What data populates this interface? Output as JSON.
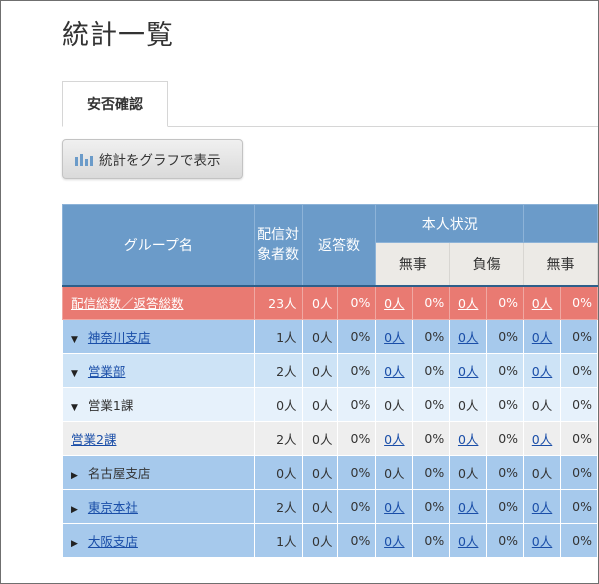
{
  "page": {
    "title": "統計一覧",
    "tab_label": "安否確認",
    "graph_button_label": "統計をグラフで表示",
    "graph_icon": "bar-chart-icon"
  },
  "table": {
    "headers": {
      "group_name": "グループ名",
      "delivery_count": "配信対象者数",
      "reply_count": "返答数",
      "self_status": "本人状況",
      "safe": "無事",
      "injured": "負傷",
      "safe2": "無事"
    },
    "rows": [
      {
        "name": "配信総数／返答総数",
        "link": true,
        "toggle": "",
        "count": "23人",
        "reply_n": "0人",
        "reply_p": "0%",
        "safe_n": "0人",
        "safe_p": "0%",
        "inj_n": "0人",
        "inj_p": "0%",
        "s2_n": "0人",
        "s2_p": "0%"
      },
      {
        "name": "神奈川支店",
        "link": true,
        "toggle": "▼",
        "count": "1人",
        "reply_n": "0人",
        "reply_p": "0%",
        "safe_n": "0人",
        "safe_p": "0%",
        "inj_n": "0人",
        "inj_p": "0%",
        "s2_n": "0人",
        "s2_p": "0%"
      },
      {
        "name": "営業部",
        "link": true,
        "toggle": "▼",
        "count": "2人",
        "reply_n": "0人",
        "reply_p": "0%",
        "safe_n": "0人",
        "safe_p": "0%",
        "inj_n": "0人",
        "inj_p": "0%",
        "s2_n": "0人",
        "s2_p": "0%"
      },
      {
        "name": "営業1課",
        "link": false,
        "toggle": "▼",
        "count": "0人",
        "reply_n": "0人",
        "reply_p": "0%",
        "safe_n": "0人",
        "safe_p": "0%",
        "inj_n": "0人",
        "inj_p": "0%",
        "s2_n": "0人",
        "s2_p": "0%"
      },
      {
        "name": "営業2課",
        "link": true,
        "toggle": "",
        "count": "2人",
        "reply_n": "0人",
        "reply_p": "0%",
        "safe_n": "0人",
        "safe_p": "0%",
        "inj_n": "0人",
        "inj_p": "0%",
        "s2_n": "0人",
        "s2_p": "0%"
      },
      {
        "name": "名古屋支店",
        "link": false,
        "toggle": "▶",
        "count": "0人",
        "reply_n": "0人",
        "reply_p": "0%",
        "safe_n": "0人",
        "safe_p": "0%",
        "inj_n": "0人",
        "inj_p": "0%",
        "s2_n": "0人",
        "s2_p": "0%"
      },
      {
        "name": "東京本社",
        "link": true,
        "toggle": "▶",
        "count": "2人",
        "reply_n": "0人",
        "reply_p": "0%",
        "safe_n": "0人",
        "safe_p": "0%",
        "inj_n": "0人",
        "inj_p": "0%",
        "s2_n": "0人",
        "s2_p": "0%"
      },
      {
        "name": "大阪支店",
        "link": true,
        "toggle": "▶",
        "count": "1人",
        "reply_n": "0人",
        "reply_p": "0%",
        "safe_n": "0人",
        "safe_p": "0%",
        "inj_n": "0人",
        "inj_p": "0%",
        "s2_n": "0人",
        "s2_p": "0%"
      }
    ]
  },
  "colors": {
    "header_blue": "#6b9bc9",
    "total_row": "#e97a72",
    "level0": "#a6c9ec",
    "level1": "#cde3f6",
    "level2": "#e6f1fb",
    "level3": "#eeeeee",
    "link": "#1a4ea8"
  }
}
